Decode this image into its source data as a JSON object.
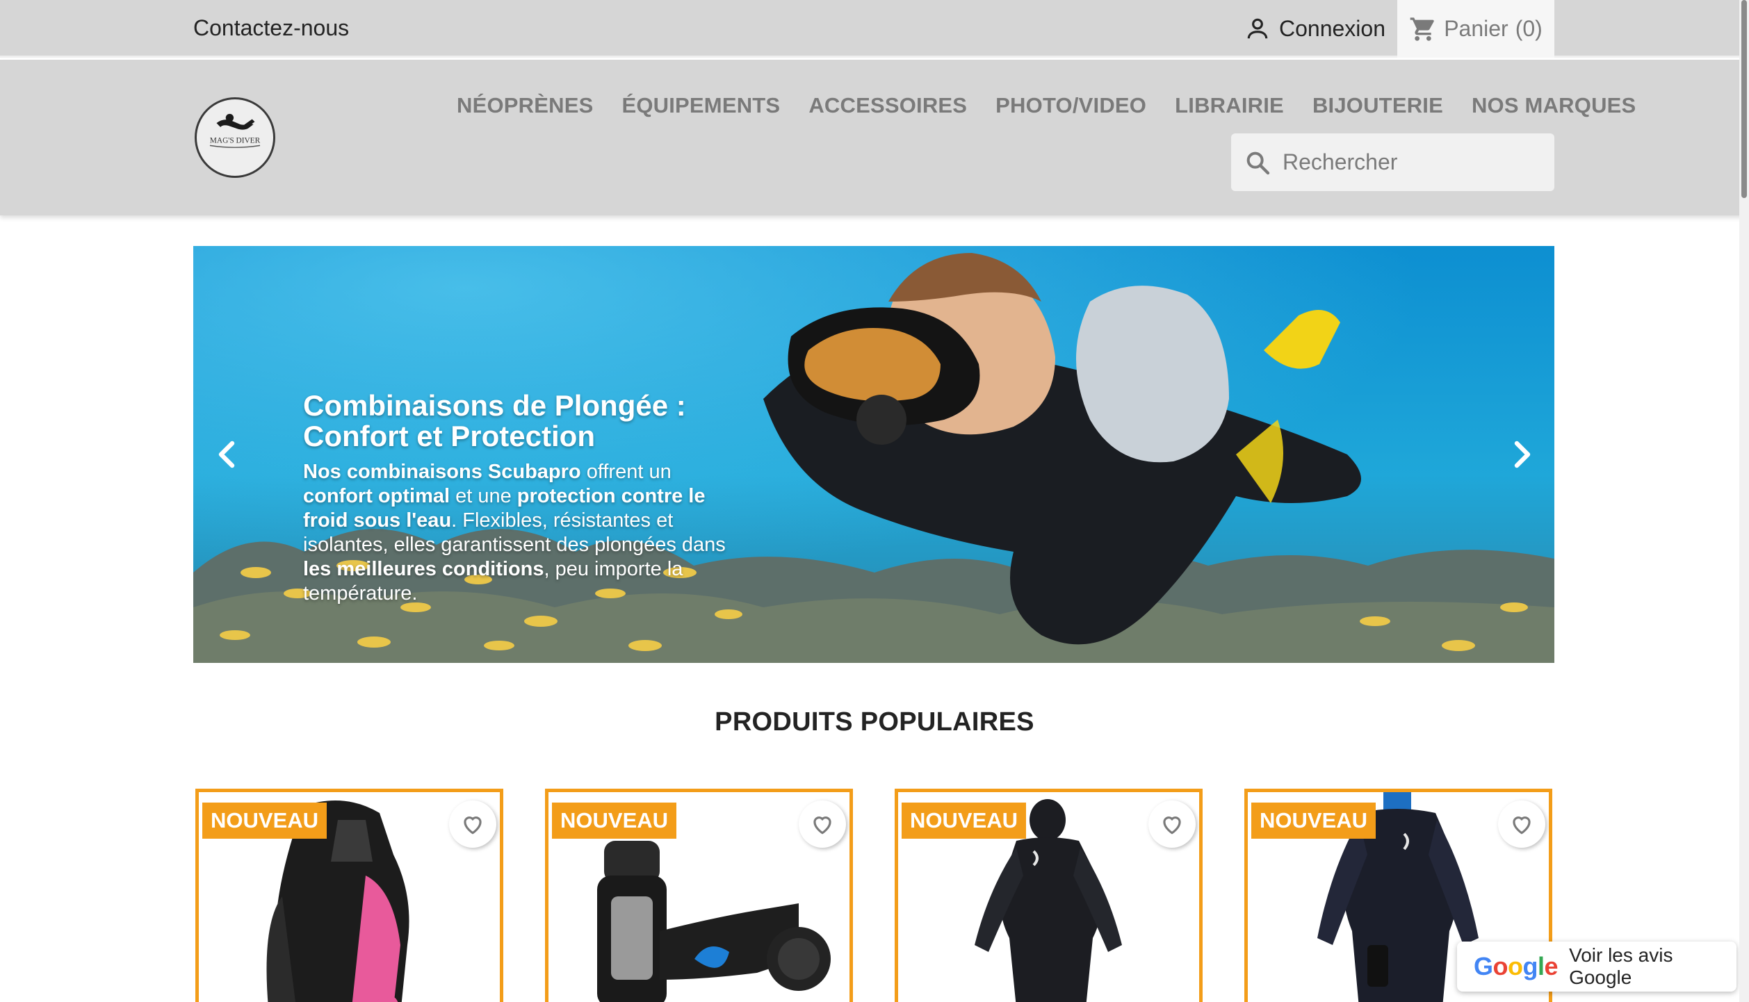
{
  "topbar": {
    "contact_label": "Contactez-nous",
    "login_label": "Connexion",
    "cart_label": "Panier",
    "cart_count": "(0)"
  },
  "header": {
    "logo_text": "MAG'S DIVER",
    "nav": [
      {
        "label": "NÉOPRÈNES"
      },
      {
        "label": "ÉQUIPEMENTS"
      },
      {
        "label": "ACCESSOIRES"
      },
      {
        "label": "PHOTO/VIDEO"
      },
      {
        "label": "LIBRAIRIE"
      },
      {
        "label": "BIJOUTERIE"
      },
      {
        "label": "NOS MARQUES"
      }
    ],
    "search": {
      "placeholder": "Rechercher"
    }
  },
  "hero": {
    "title_line1": "Combinaisons de Plongée :",
    "title_line2": "Confort et Protection",
    "text": [
      {
        "t": "Nos combinaisons Scubapro",
        "b": true
      },
      {
        "t": " offrent un ",
        "b": false
      },
      {
        "t": "confort optimal",
        "b": true
      },
      {
        "t": " et une ",
        "b": false
      },
      {
        "t": "protection contre le froid sous l'eau",
        "b": true
      },
      {
        "t": ". Flexibles, résistantes et isolantes, elles garantissent des plongées dans ",
        "b": false
      },
      {
        "t": "les meilleures conditions",
        "b": true
      },
      {
        "t": ", peu importe la température.",
        "b": false
      }
    ]
  },
  "section": {
    "title": "PRODUITS POPULAIRES"
  },
  "products": [
    {
      "badge": "NOUVEAU",
      "kind": "bcd"
    },
    {
      "badge": "NOUVEAU",
      "kind": "regulator"
    },
    {
      "badge": "NOUVEAU",
      "kind": "wetsuit"
    },
    {
      "badge": "NOUVEAU",
      "kind": "semidry"
    }
  ],
  "google_widget": {
    "logo_letters": [
      "G",
      "o",
      "o",
      "g",
      "l",
      "e"
    ],
    "logo_colors": [
      "#4285F4",
      "#EA4335",
      "#FBBC05",
      "#4285F4",
      "#34A853",
      "#EA4335"
    ],
    "label": "Voir les avis Google"
  },
  "colors": {
    "accent": "#f39d19",
    "header_bg": "#d6d6d6",
    "nav_text": "#7a7a7a"
  }
}
